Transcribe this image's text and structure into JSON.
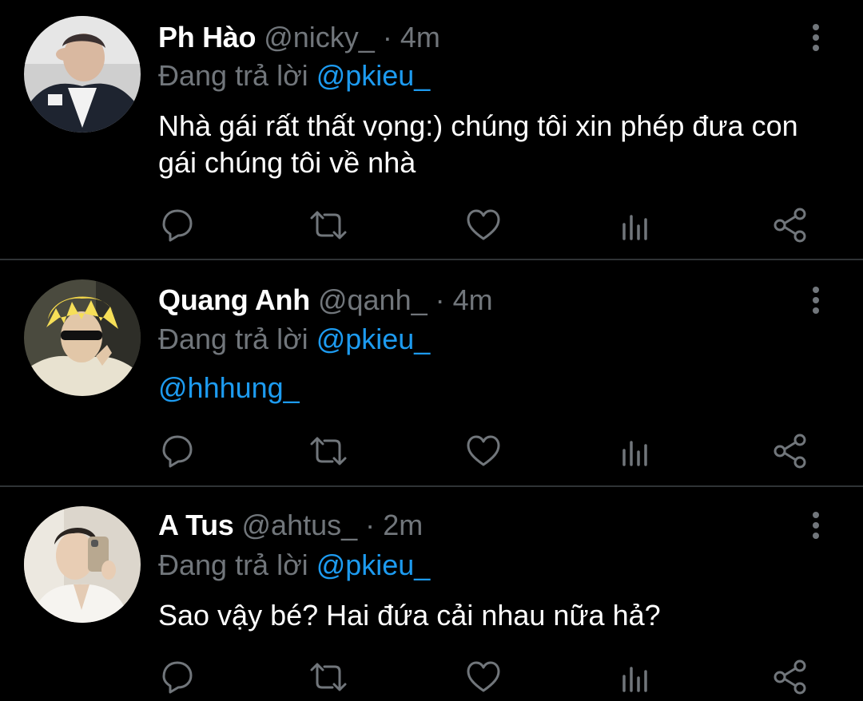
{
  "reply_prefix": "Đang trả lời",
  "separator": "·",
  "colors": {
    "background": "#000000",
    "text": "#ffffff",
    "muted": "#71767b",
    "accent": "#1d9bf0",
    "divider": "#2f3336"
  },
  "icons": {
    "reply": "speech-bubble-icon",
    "retweet": "retweet-arrows-icon",
    "like": "heart-icon",
    "views": "bar-chart-icon",
    "share": "share-nodes-icon",
    "more": "vertical-dots-icon"
  },
  "tweets": [
    {
      "name": "Ph Hào",
      "handle": "@nicky_",
      "time": "4m",
      "reply_to": "@pkieu_",
      "text": "Nhà gái rất thất vọng:) chúng tôi xin phép đưa con gái chúng tôi về nhà"
    },
    {
      "name": "Quang Anh",
      "handle": "@qanh_",
      "time": "4m",
      "reply_to": "@pkieu_",
      "text": "@hhhung_"
    },
    {
      "name": "A Tus",
      "handle": "@ahtus_",
      "time": "2m",
      "reply_to": "@pkieu_",
      "text": "Sao vậy bé? Hai đứa cải nhau nữa hả?"
    }
  ]
}
